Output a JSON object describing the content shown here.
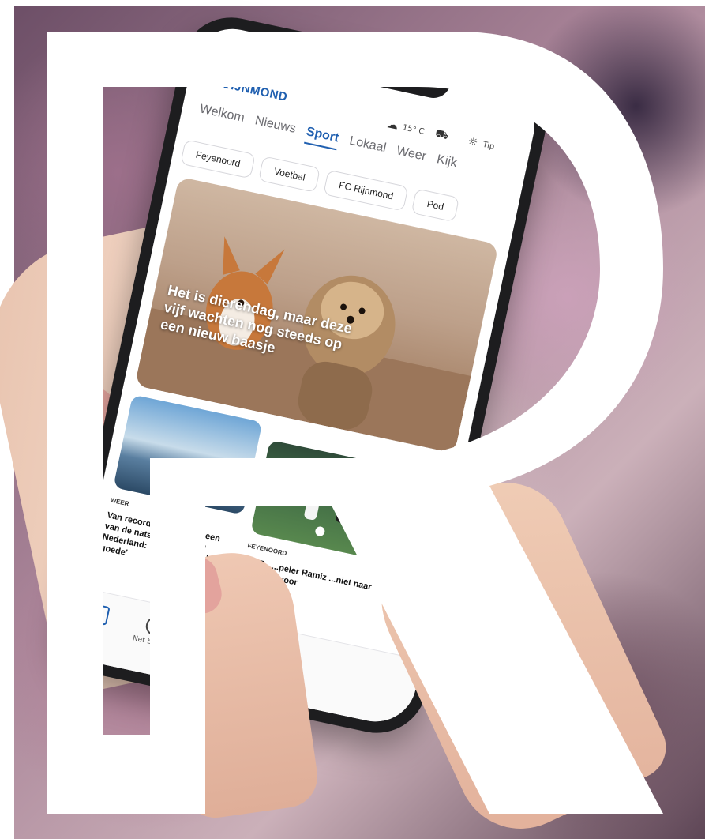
{
  "app": {
    "logo_letter": "R",
    "logo_text": "IJNMOND"
  },
  "nav": {
    "tabs": [
      "Welkom",
      "Nieuws",
      "Sport",
      "Lokaal",
      "Weer",
      "Kijk"
    ],
    "active": "Sport",
    "weather": "15° C",
    "tip": "Tip"
  },
  "subnav": {
    "chips": [
      "Feyenoord",
      "Voetbal",
      "FC Rijnmond",
      "Pod"
    ]
  },
  "hero": {
    "title": "Het is dierendag, maar deze vijf wachten nog steeds op een nieuw baasje"
  },
  "cards": [
    {
      "category": "WEER",
      "title": "Van recorddroogte naar een van de natste regio's van Nederland: 'Het is i... van het goede'"
    },
    {
      "category": "FEYENOORD",
      "title": "FC T... ...peler Ramiz ...niet naar ...n klaar voor"
    }
  ],
  "tabbar": {
    "items": [
      "",
      "Net binnen"
    ]
  },
  "colors": {
    "brand": "#1f5fb0",
    "background_letter": "#ffffff"
  }
}
